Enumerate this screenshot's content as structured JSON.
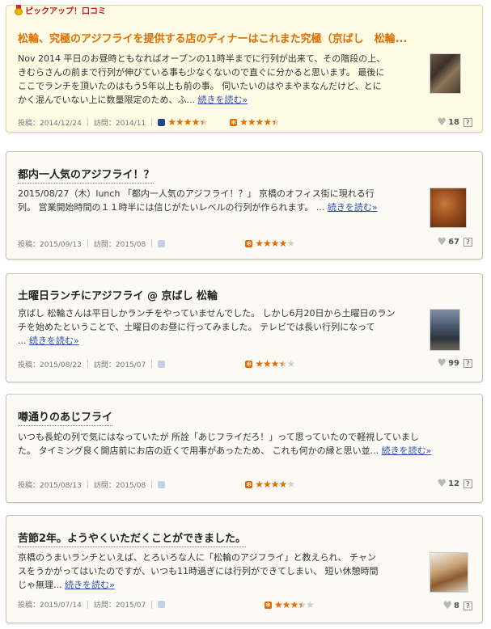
{
  "reviews": [
    {
      "pickup_label": "ピックアップ！口コミ",
      "title": "松輪、究極のアジフライを提供する店のディナーはこれまた究極（京ばし　松輪...",
      "body_lines": [
        "Nov 2014 平日のお昼時ともなればオープンの11時半までに行列が出来て、その階段の上、",
        "きむらさんの前まで行列が伸びている事も少なくないので直ぐに分かると思います。 最後に",
        "ここでランチを頂いたのはもう5年以上も前の事。 伺いたいのはやまやまなんだけど、とに",
        "かく混んでいない上に数量限定のため、ふ..."
      ],
      "more": "続きを読む»",
      "posted": "投稿：2014/12/24",
      "visited": "訪問：2014/11",
      "dinner_rating": "★★★★★",
      "lunch_rating": "★★★★★",
      "likes": "18",
      "help": "?"
    },
    {
      "title": "都内一人気のアジフライ！？",
      "body_lines": [
        "2015/08/27（木）lunch 「都内一人気のアジフライ！？」 京橋のオフィス街に現れる行",
        "列。 営業開始時間の１１時半には信じがたいレベルの行列が作られます。 ..."
      ],
      "more": "続きを読む»",
      "posted": "投稿：2015/09/13",
      "visited": "訪問：2015/08",
      "lunch_rating": "★★★★★",
      "likes": "67",
      "help": "?"
    },
    {
      "title": "土曜日ランチにアジフライ @ 京ばし 松輪",
      "body_lines": [
        "京ばし 松輪さんは平日しかランチをやっていませんでした。 しかし6月20日から土曜日のラン",
        "チを始めたということで、土曜日のお昼に行ってみました。 テレビでは長い行列になって",
        "..."
      ],
      "more": "続きを読む»",
      "posted": "投稿：2015/08/22",
      "visited": "訪問：2015/07",
      "lunch_rating": "★★★★★",
      "likes": "99",
      "help": "?"
    },
    {
      "title": "噂通りのあじフライ",
      "body_lines": [
        "いつも長蛇の列で気にはなっていたが 所詮「あじフライだろ！」って思っていたので軽視していまし",
        "た。 タイミング良く開店前にお店の近くで用事があったため、 これも何かの縁と思い並..."
      ],
      "more": "続きを読む»",
      "posted": "投稿：2015/08/13",
      "visited": "訪問：2015/08",
      "lunch_rating": "★★★★★",
      "likes": "12",
      "help": "?"
    },
    {
      "title": "苦節2年。ようやくいただくことができました。",
      "body_lines": [
        "京橋のうまいランチといえば、とろいろな人に「松輪のアジフライ」と教えられ、 チャン",
        "スをうかがってはいたのですが、いつも11時過ぎには行列ができてしまい、 短い休憩時間",
        "じゃ無理..."
      ],
      "more": "続きを読む»",
      "posted": "投稿：2015/07/14",
      "visited": "訪問：2015/07",
      "lunch_rating": "★★★★★",
      "likes": "8",
      "help": "?"
    }
  ],
  "ratings_visual": [
    {
      "dinner": 4.5,
      "lunch": 4.5
    },
    {
      "lunch": 4.0
    },
    {
      "lunch": 3.5
    },
    {
      "lunch": 4.0
    },
    {
      "lunch": 3.5
    }
  ],
  "colors": {
    "accent": "#e06e00",
    "pickup_bg": "#fffbe4",
    "link": "#2e4fb0",
    "moon": "#27458c"
  }
}
